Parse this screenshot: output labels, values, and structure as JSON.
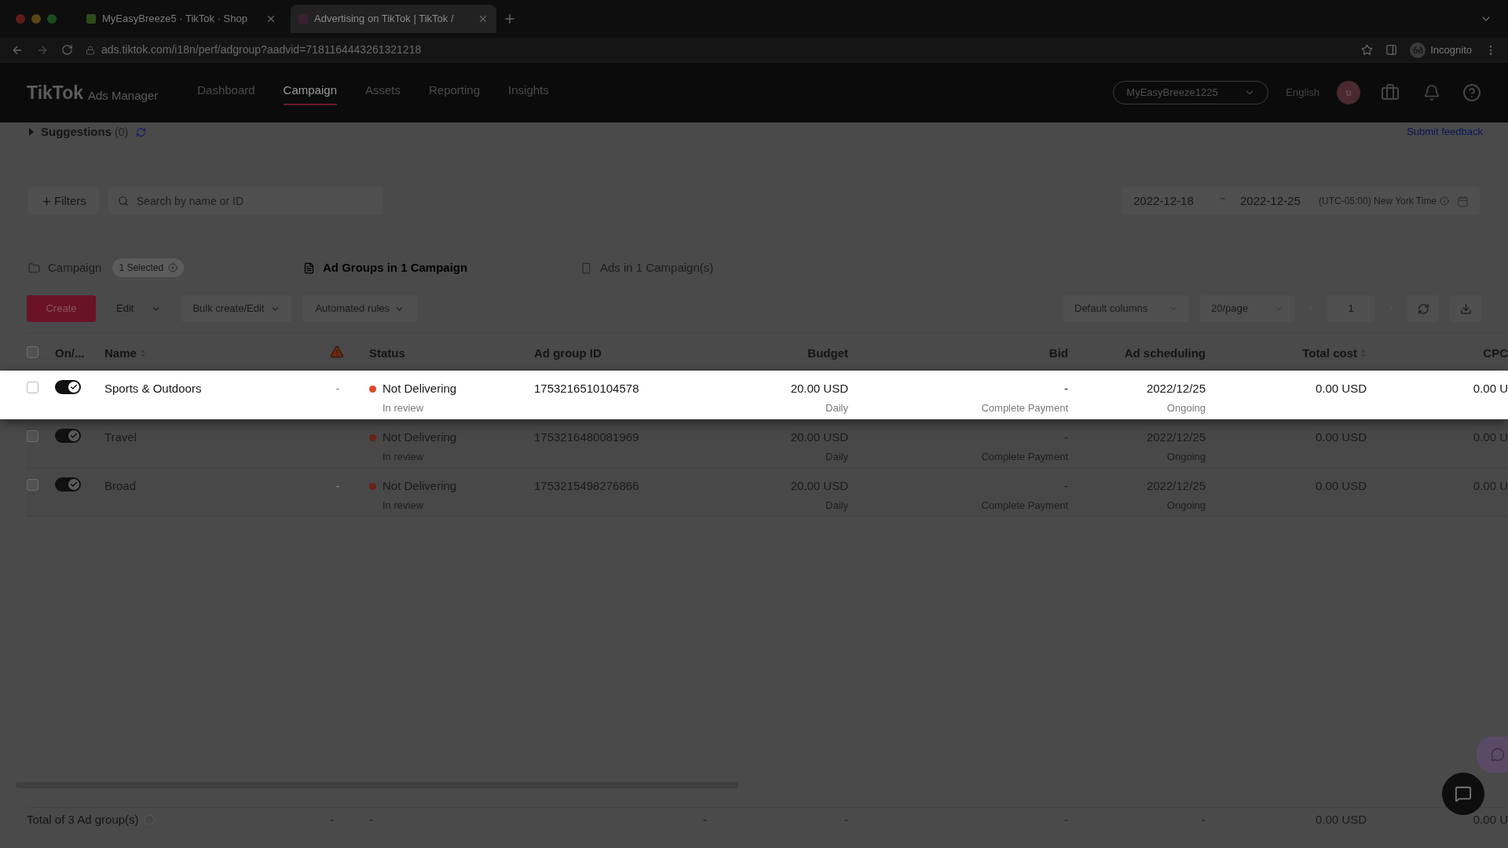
{
  "browser": {
    "tabs": [
      {
        "title": "MyEasyBreeze5 · TikTok · Shop",
        "selected": false
      },
      {
        "title": "Advertising on TikTok | TikTok /",
        "selected": true
      }
    ],
    "url": "ads.tiktok.com/i18n/perf/adgroup?aadvid=7181164443261321218",
    "profile": "Incognito"
  },
  "header": {
    "brand": "TikTok",
    "product": "Ads Manager",
    "nav": [
      {
        "label": "Dashboard",
        "selected": false
      },
      {
        "label": "Campaign",
        "selected": true
      },
      {
        "label": "Assets",
        "selected": false
      },
      {
        "label": "Reporting",
        "selected": false
      },
      {
        "label": "Insights",
        "selected": false
      }
    ],
    "account": "MyEasyBreeze1225",
    "language": "English",
    "avatar": "u"
  },
  "suggestions": {
    "label": "Suggestions",
    "count": "(0)",
    "expanded": false
  },
  "feedback": "Submit feedback",
  "filters": {
    "button": "Filters",
    "search_placeholder": "Search by name or ID",
    "date_start": "2022-12-18",
    "date_separator": "~",
    "date_end": "2022-12-25",
    "timezone": "(UTC-05:00) New York Time"
  },
  "levels": [
    {
      "label": "Campaign",
      "badge": "1 Selected",
      "selected": false
    },
    {
      "label": "Ad Groups in 1 Campaign",
      "selected": true
    },
    {
      "label": "Ads in 1 Campaign(s)",
      "selected": false
    }
  ],
  "toolbar": {
    "create": "Create",
    "edit": {
      "label": "Edit",
      "disabled": true
    },
    "bulk": "Bulk create/Edit",
    "rules": "Automated rules",
    "columns": "Default columns",
    "page_size": "20/page",
    "page": "1"
  },
  "table": {
    "select_all_checked": false,
    "columns": [
      {
        "label": "On/..."
      },
      {
        "label": "Name",
        "sortable": true
      },
      {
        "label": "Status"
      },
      {
        "label": "Ad group ID"
      },
      {
        "label": "Budget"
      },
      {
        "label": "Bid"
      },
      {
        "label": "Ad scheduling"
      },
      {
        "label": "Total cost",
        "sortable": true
      },
      {
        "label": "CPC"
      }
    ],
    "rows": [
      {
        "checked": false,
        "on": true,
        "highlighted": true,
        "name": "Sports & Outdoors",
        "warning": "-",
        "status": "Not Delivering",
        "status_detail": "In review",
        "id": "1753216510104578",
        "budget": "20.00 USD",
        "budget_detail": "Daily",
        "bid": "-",
        "bid_detail": "Complete Payment",
        "schedule": "2022/12/25",
        "schedule_detail": "Ongoing",
        "total_cost": "0.00 USD",
        "cpc": "0.00 U"
      },
      {
        "checked": false,
        "on": true,
        "highlighted": false,
        "name": "Travel",
        "status": "Not Delivering",
        "status_detail": "In review",
        "id": "1753216480081969",
        "budget": "20.00 USD",
        "budget_detail": "Daily",
        "bid": "-",
        "bid_detail": "Complete Payment",
        "schedule": "2022/12/25",
        "schedule_detail": "Ongoing",
        "total_cost": "0.00 USD",
        "cpc": "0.00 U"
      },
      {
        "checked": false,
        "on": true,
        "highlighted": false,
        "name": "Broad",
        "warning": "-",
        "status": "Not Delivering",
        "status_detail": "In review",
        "id": "1753215498276866",
        "budget": "20.00 USD",
        "budget_detail": "Daily",
        "bid": "-",
        "bid_detail": "Complete Payment",
        "schedule": "2022/12/25",
        "schedule_detail": "Ongoing",
        "total_cost": "0.00 USD",
        "cpc": "0.00 U"
      }
    ],
    "total": {
      "label": "Total of 3 Ad group(s)",
      "cells": [
        "-",
        "-",
        "-",
        "-",
        "-",
        "-",
        "0.00 USD",
        "0.00 U"
      ]
    }
  }
}
